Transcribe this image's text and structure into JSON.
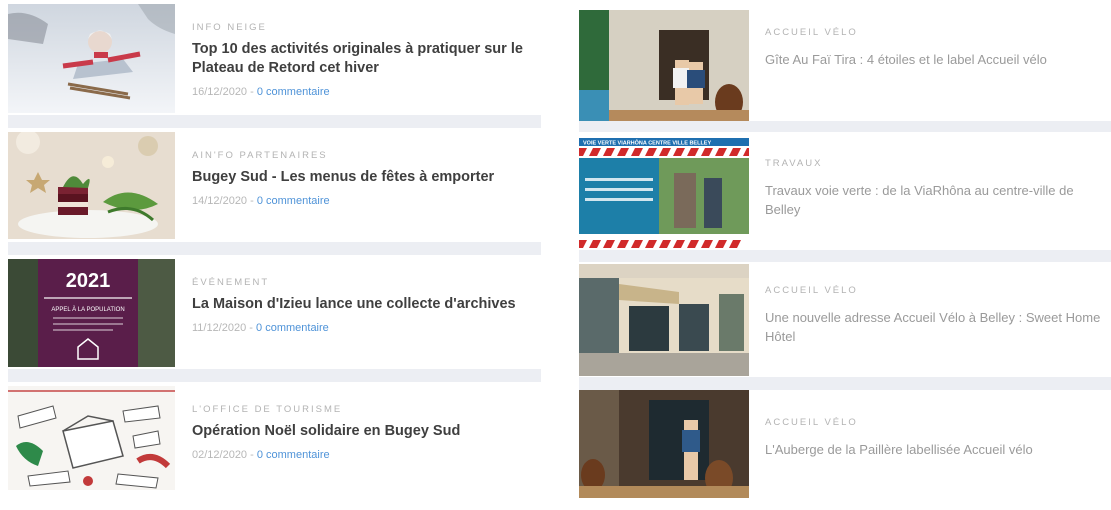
{
  "left_column": [
    {
      "category": "INFO NEIGE",
      "title": "Top 10 des activités originales à pratiquer sur le Plateau de Retord cet hiver",
      "date": "16/12/2020",
      "separator": " - ",
      "comments": "0 commentaire"
    },
    {
      "category": "AIN'FO PARTENAIRES",
      "title": "Bugey Sud - Les menus de fêtes à emporter",
      "date": "14/12/2020",
      "separator": " - ",
      "comments": "0 commentaire"
    },
    {
      "category": "ÉVÉNEMENT",
      "title": "La Maison d'Izieu lance une collecte d'archives",
      "date": "11/12/2020",
      "separator": " - ",
      "comments": "0 commentaire",
      "thumb_text": {
        "year": "2021",
        "subtitle": "APPEL À LA POPULATION"
      }
    },
    {
      "category": "L'OFFICE DE TOURISME",
      "title": "Opération Noël solidaire en Bugey Sud",
      "date": "02/12/2020",
      "separator": " - ",
      "comments": "0 commentaire"
    }
  ],
  "right_column": [
    {
      "category": "ACCUEIL VÉLO",
      "title": "Gîte Au Faï Tira : 4 étoiles et le label Accueil vélo"
    },
    {
      "category": "TRAVAUX",
      "title": "Travaux voie verte : de la ViaRhôna au centre-ville de Belley",
      "thumb_text": {
        "banner": "VOIE VERTE VIARHÔNA CENTRE VILLE BELLEY"
      }
    },
    {
      "category": "ACCUEIL VÉLO",
      "title": "Une nouvelle adresse Accueil Vélo à Belley : Sweet Home Hôtel"
    },
    {
      "category": "ACCUEIL VÉLO",
      "title": "L'Auberge de la Paillère labellisée Accueil vélo"
    }
  ],
  "colors": {
    "separator": "#eceef3",
    "category": "#b3b3b3",
    "title": "#3f3f3f",
    "link": "#4f93d8"
  }
}
